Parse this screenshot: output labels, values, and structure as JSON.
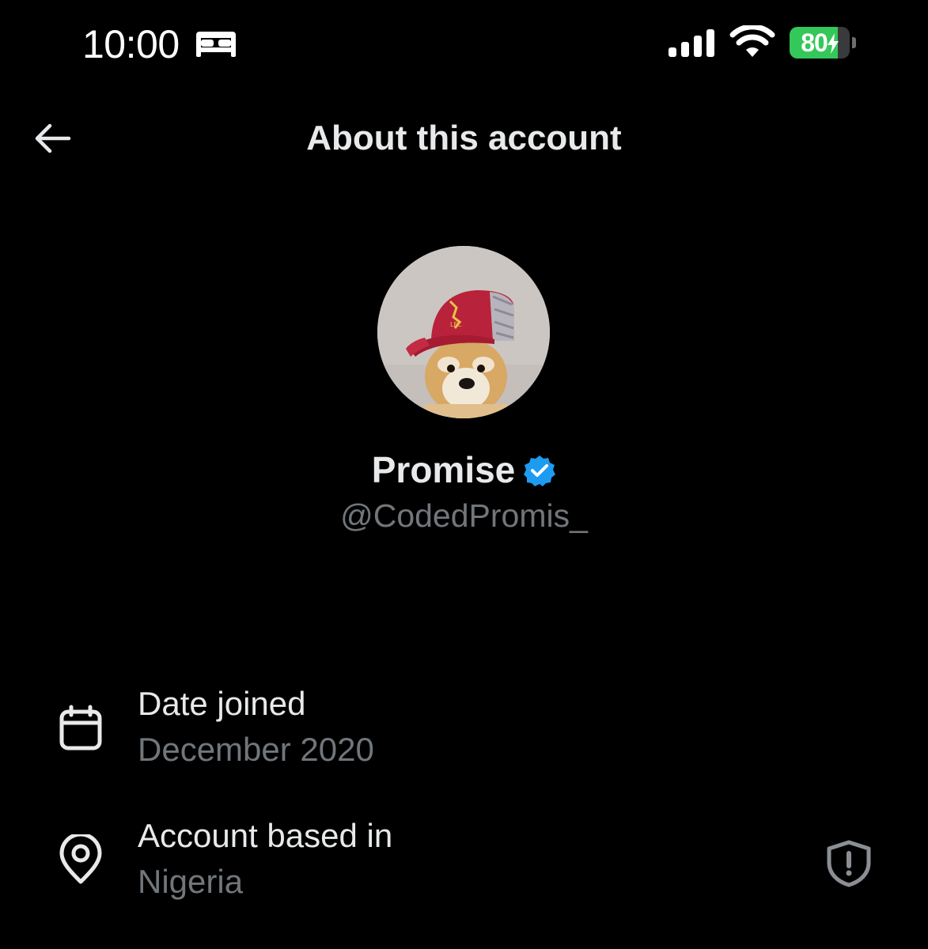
{
  "status_bar": {
    "time": "10:00",
    "sleep_icon": "bed-icon",
    "signal_icon": "cellular-signal-icon",
    "wifi_icon": "wifi-icon",
    "battery_level": "80",
    "battery_percent": 80,
    "battery_charging": true,
    "battery_color": "#34c759"
  },
  "header": {
    "back_icon": "back-arrow-icon",
    "title": "About this account"
  },
  "profile": {
    "avatar_description_icon": "avatar-image",
    "display_name": "Promise",
    "verified_icon": "verified-badge-icon",
    "verified_color": "#1d9bf0",
    "handle": "@CodedPromis_"
  },
  "details": [
    {
      "icon": "calendar-icon",
      "label": "Date joined",
      "value": "December 2020"
    },
    {
      "icon": "location-pin-icon",
      "label": "Account based in",
      "value": "Nigeria",
      "trailing_icon": "shield-alert-icon"
    }
  ],
  "colors": {
    "background": "#000000",
    "primary_text": "#e7e9ea",
    "secondary_text": "#71767b"
  }
}
